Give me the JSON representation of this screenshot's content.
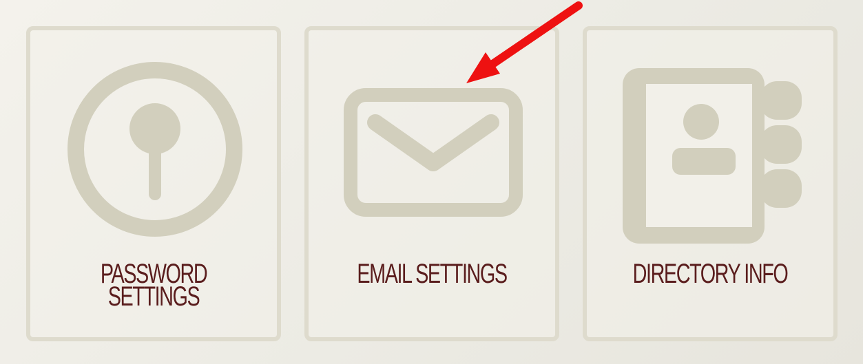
{
  "tiles": [
    {
      "id": "password",
      "label": "PASSWORD\nSETTINGS",
      "icon": "keyhole-icon"
    },
    {
      "id": "email",
      "label": "EMAIL SETTINGS",
      "icon": "envelope-icon"
    },
    {
      "id": "directory",
      "label": "DIRECTORY INFO",
      "icon": "address-book-icon"
    }
  ],
  "colors": {
    "icon": "#d2cfbd",
    "border": "#dedbcd",
    "label": "#5a1d1d",
    "arrow": "#ee1111",
    "background": "#efeee7"
  },
  "annotation": {
    "icon": "red-arrow-icon"
  }
}
